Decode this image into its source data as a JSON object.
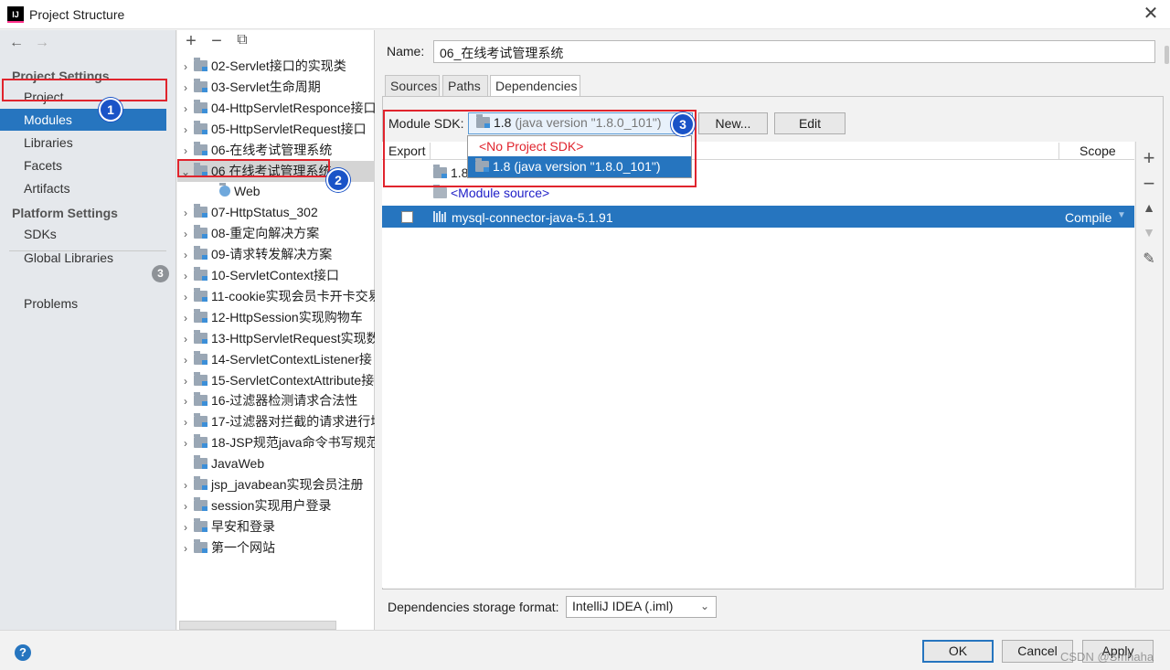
{
  "window": {
    "title": "Project Structure",
    "app_icon": "IJ"
  },
  "left_nav": {
    "project_settings": "Project Settings",
    "items_project": [
      "Project",
      "Modules",
      "Libraries",
      "Facets",
      "Artifacts"
    ],
    "platform_settings": "Platform Settings",
    "items_platform": [
      "SDKs",
      "Global Libraries"
    ],
    "problems": "Problems",
    "problems_count": "3",
    "selected": "Modules"
  },
  "annotations": {
    "badge1": "1",
    "badge2": "2",
    "badge3": "3"
  },
  "tree": {
    "toolbar": {
      "add": "+",
      "remove": "−",
      "copy": "⧉"
    },
    "rows": [
      "02-Servlet接口的实现类",
      "03-Servlet生命周期",
      "04-HttpServletResponce接口",
      "05-HttpServletRequest接口",
      "06-在线考试管理系统",
      "06 在线考试管理系统",
      "Web",
      "07-HttpStatus_302",
      "08-重定向解决方案",
      "09-请求转发解决方案",
      "10-ServletContext接口",
      "11-cookie实现会员卡开卡交易",
      "12-HttpSession实现购物车",
      "13-HttpServletRequest实现数",
      "14-ServletContextListener接",
      "15-ServletContextAttribute接",
      "16-过滤器检测请求合法性",
      "17-过滤器对拦截的请求进行增",
      "18-JSP规范java命令书写规范",
      "JavaWeb",
      "jsp_javabean实现会员注册",
      "session实现用户登录",
      "早安和登录",
      "第一个网站"
    ]
  },
  "module": {
    "name_label": "Name:",
    "name_value": "06_在线考试管理系统",
    "tabs": [
      "Sources",
      "Paths",
      "Dependencies"
    ],
    "active_tab": "Dependencies"
  },
  "sdk": {
    "label": "Module SDK:",
    "selected_main": "1.8",
    "selected_version": "(java version \"1.8.0_101\")",
    "new_button": "New...",
    "edit_button": "Edit",
    "options": [
      "<No Project SDK>",
      "1.8 (java version \"1.8.0_101\")"
    ]
  },
  "dependencies": {
    "col_export": "Export",
    "col_scope": "Scope",
    "jdk_row": "1.8",
    "module_source": "<Module source>",
    "library_name": "mysql-connector-java-5.1.91",
    "library_scope": "Compile"
  },
  "storage": {
    "label": "Dependencies storage format:",
    "value": "IntelliJ IDEA (.iml)"
  },
  "footer": {
    "help": "?",
    "ok": "OK",
    "cancel": "Cancel",
    "apply": "Apply",
    "watermark": "CSDN @Smhaha"
  },
  "colors": {
    "selection": "#2675bf",
    "annotation_red": "#e0242d",
    "badge_blue": "#1a53c7"
  }
}
